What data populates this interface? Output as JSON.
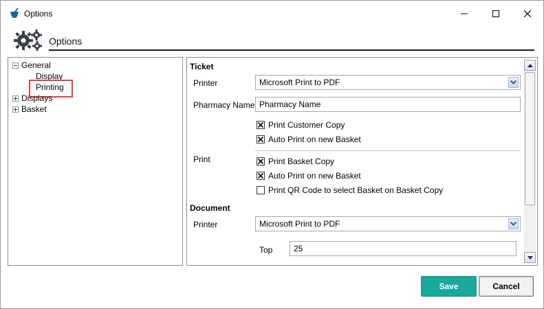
{
  "window": {
    "title": "Options",
    "icon": "mortar-pestle-icon"
  },
  "header": {
    "title": "Options",
    "icon": "gears-icon"
  },
  "tree": {
    "items": [
      {
        "label": "General",
        "expanded": true
      },
      {
        "label": "Display"
      },
      {
        "label": "Printing",
        "highlighted": true
      },
      {
        "label": "Displays",
        "expanded": false
      },
      {
        "label": "Basket",
        "expanded": false
      }
    ]
  },
  "ticket": {
    "section_title": "Ticket",
    "printer_label": "Printer",
    "printer_value": "Microsoft Print to PDF",
    "pharmacy_name_label": "Pharmacy Name",
    "pharmacy_name_value": "Pharmacy Name",
    "print_customer_copy": {
      "label": "Print Customer Copy",
      "checked": true
    },
    "auto_print_customer": {
      "label": "Auto Print on new Basket",
      "checked": true
    },
    "print_label": "Print",
    "print_basket_copy": {
      "label": "Print Basket Copy",
      "checked": true
    },
    "auto_print_basket": {
      "label": "Auto Print on new Basket",
      "checked": true
    },
    "print_qr_code": {
      "label": "Print QR Code to select Basket on Basket Copy",
      "checked": false
    }
  },
  "document": {
    "section_title": "Document",
    "printer_label": "Printer",
    "printer_value": "Microsoft Print to PDF",
    "top_label": "Top",
    "top_value": "25"
  },
  "buttons": {
    "save_label": "Save",
    "cancel_label": "Cancel"
  },
  "colors": {
    "save_button": "#1aa89a",
    "highlight_box": "#e0423c"
  }
}
